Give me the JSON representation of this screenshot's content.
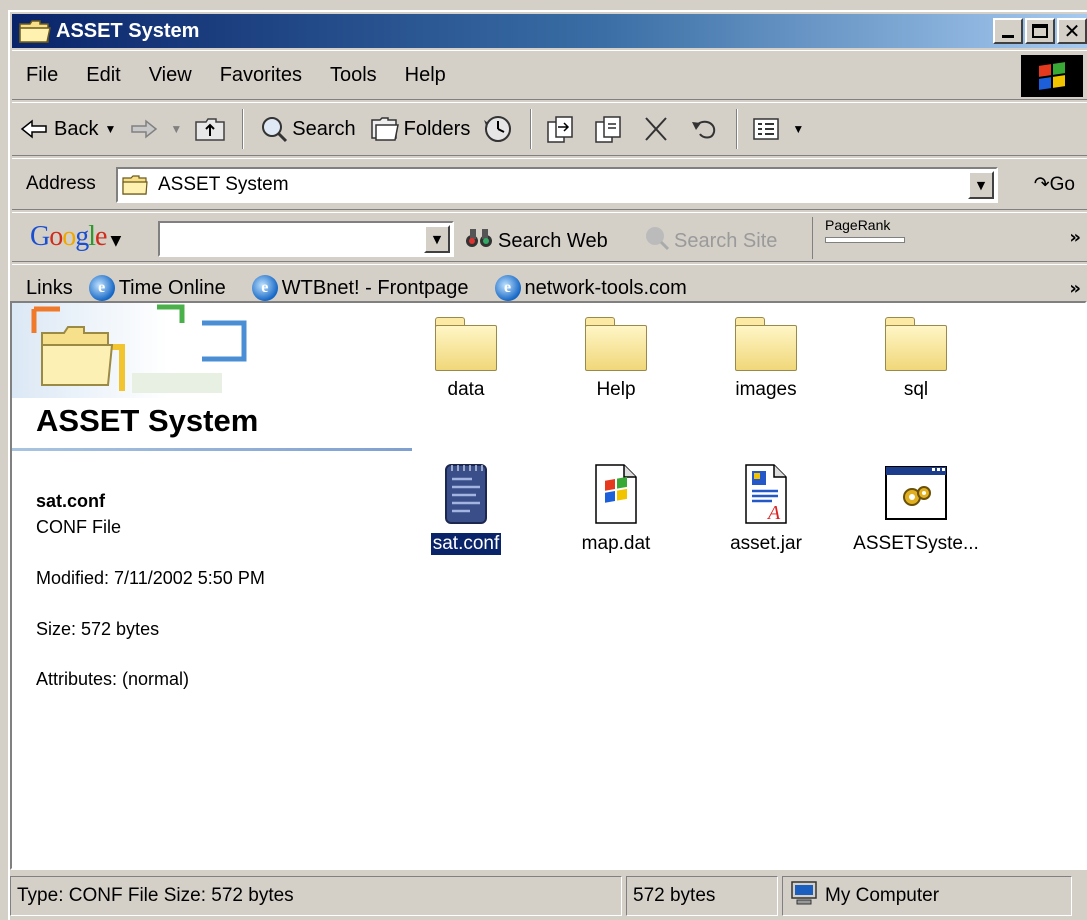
{
  "window": {
    "title": "ASSET System"
  },
  "menu": [
    "File",
    "Edit",
    "View",
    "Favorites",
    "Tools",
    "Help"
  ],
  "toolbar": {
    "back": "Back",
    "search": "Search",
    "folders": "Folders"
  },
  "address": {
    "label": "Address",
    "value": "ASSET System",
    "go": "Go"
  },
  "google": {
    "logo": "Google",
    "search_web": "Search Web",
    "search_site": "Search Site",
    "pagerank": "PageRank",
    "query": ""
  },
  "links": {
    "label": "Links",
    "items": [
      "Time Online",
      "WTBnet! - Frontpage",
      "network-tools.com"
    ]
  },
  "details": {
    "folder_title": "ASSET System",
    "file_name": "sat.conf",
    "file_type": "CONF File",
    "modified": "Modified: 7/11/2002 5:50 PM",
    "size": "Size: 572 bytes",
    "attributes": "Attributes: (normal)"
  },
  "files": [
    {
      "name": "data",
      "type": "folder"
    },
    {
      "name": "Help",
      "type": "folder"
    },
    {
      "name": "images",
      "type": "folder"
    },
    {
      "name": "sql",
      "type": "folder"
    },
    {
      "name": "sat.conf",
      "type": "conf",
      "selected": true
    },
    {
      "name": "map.dat",
      "type": "dat"
    },
    {
      "name": "asset.jar",
      "type": "jar"
    },
    {
      "name": "ASSETSyste...",
      "type": "exe"
    }
  ],
  "status": {
    "type_size": "Type: CONF File Size: 572 bytes",
    "bytes": "572 bytes",
    "zone": "My Computer"
  }
}
